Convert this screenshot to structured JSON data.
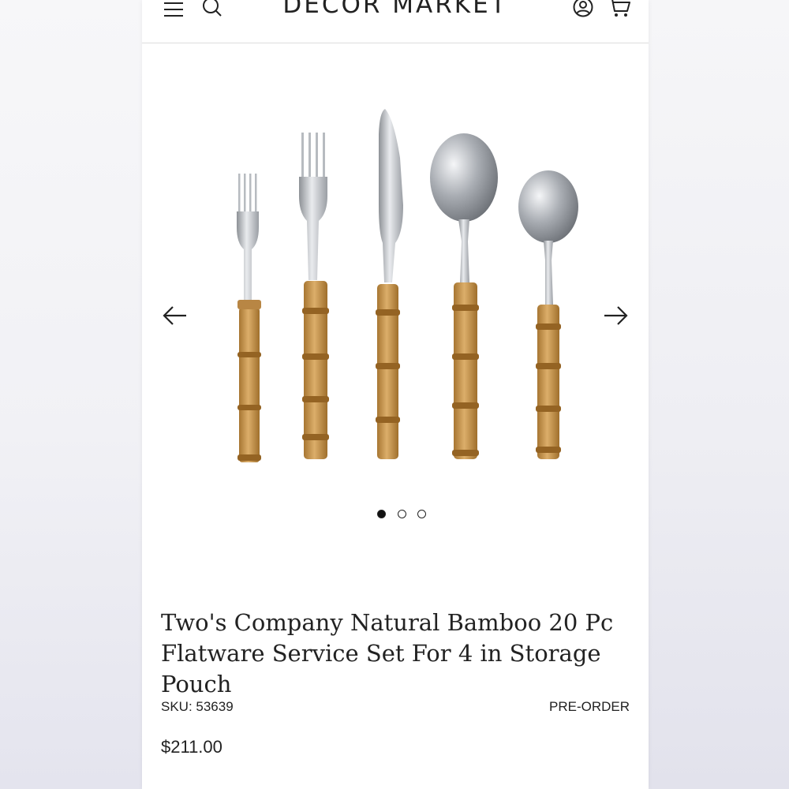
{
  "header": {
    "brand": "DECOR MARKET",
    "icons": [
      "menu-icon",
      "search-icon",
      "account-icon",
      "cart-icon"
    ]
  },
  "gallery": {
    "image_alt": "Bamboo-handled flatware set: salad fork, dinner fork, knife, soup spoon, teaspoon",
    "prev_icon": "arrow-left-icon",
    "next_icon": "arrow-right-icon",
    "slides_total": 3,
    "current_slide": 1
  },
  "product": {
    "title": "Two's Company Natural Bamboo 20 Pc Flatware Service Set For 4 in Storage Pouch",
    "sku_label": "SKU: 53639",
    "status": "PRE-ORDER",
    "price": "$211.00"
  },
  "colors": {
    "text": "#222222",
    "bamboo": "#c99a55",
    "steel": "#c4c7cc"
  }
}
